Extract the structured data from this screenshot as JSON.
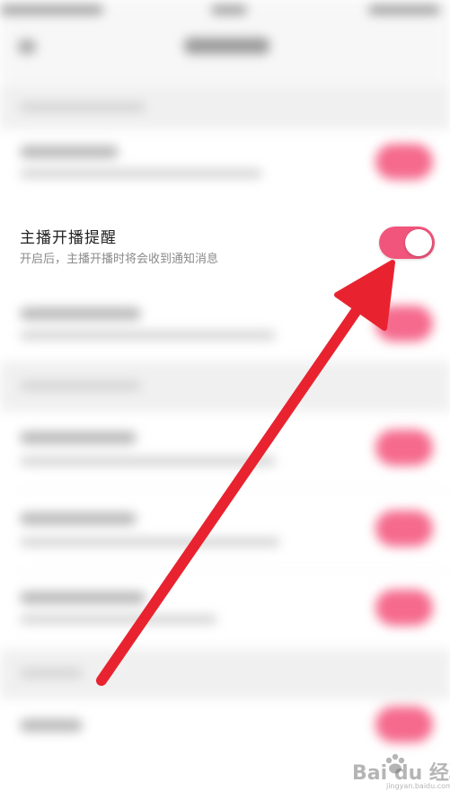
{
  "setting": {
    "title": "主播开播提醒",
    "description": "开启后，主播开播时将会收到通知消息",
    "enabled": true
  },
  "colors": {
    "accent": "#f2557b",
    "arrow": "#e8232f",
    "title_text": "#222222",
    "desc_text": "#8a8a8a"
  },
  "watermark": {
    "text": "Bai du 经验",
    "url": "jingyan.baidu.com"
  }
}
